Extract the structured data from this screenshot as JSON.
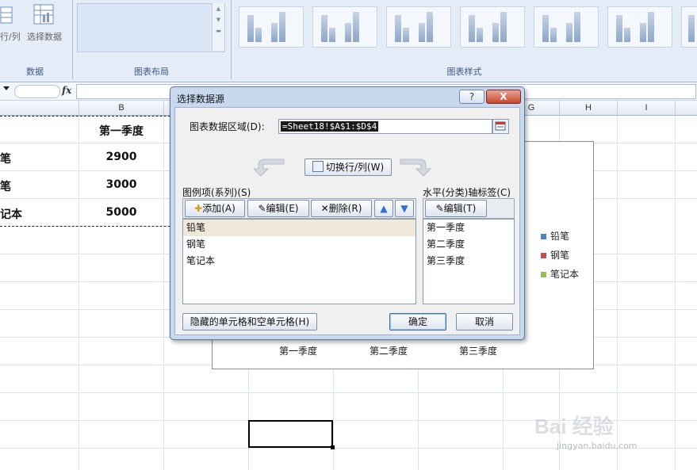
{
  "ribbon": {
    "data_group": {
      "switch_partial": "行/列",
      "select_data": "选择数据",
      "label": "数据"
    },
    "layout_group": {
      "label": "图表布局"
    },
    "styles_group": {
      "label": "图表样式"
    }
  },
  "formula_bar": {
    "fx": "fx",
    "value": ""
  },
  "columns": [
    "B",
    "G",
    "H",
    "I"
  ],
  "sheet": {
    "header_b": "第一季度",
    "rows": [
      {
        "label_partial": "笔",
        "value": "2900"
      },
      {
        "label_partial": "笔",
        "value": "3000"
      },
      {
        "label_partial": "记本",
        "value": "5000"
      }
    ]
  },
  "chart": {
    "x_labels": [
      "第一季度",
      "第二季度",
      "第三季度"
    ],
    "legend": [
      {
        "label": "铅笔",
        "color": "#4f81bd"
      },
      {
        "label": "钢笔",
        "color": "#c0504d"
      },
      {
        "label": "笔记本",
        "color": "#9bbb59"
      }
    ]
  },
  "dialog": {
    "title": "选择数据源",
    "help": "?",
    "close": "X",
    "range_label": "图表数据区域(D):",
    "range_value": "=Sheet18!$A$1:$D$4",
    "switch_button": "切换行/列(W)",
    "series_label": "图例项(系列)(S)",
    "add_button": "添加(A)",
    "edit_button": "编辑(E)",
    "delete_button": "删除(R)",
    "series": [
      "铅笔",
      "钢笔",
      "笔记本"
    ],
    "axis_label": "水平(分类)轴标签(C)",
    "axis_edit_button": "编辑(T)",
    "categories": [
      "第一季度",
      "第二季度",
      "第三季度"
    ],
    "hidden_cells_button": "隐藏的单元格和空单元格(H)",
    "ok_button": "确定",
    "cancel_button": "取消"
  },
  "watermark": {
    "brand": "Bai 经验",
    "url": "jingyan.baidu.com"
  }
}
